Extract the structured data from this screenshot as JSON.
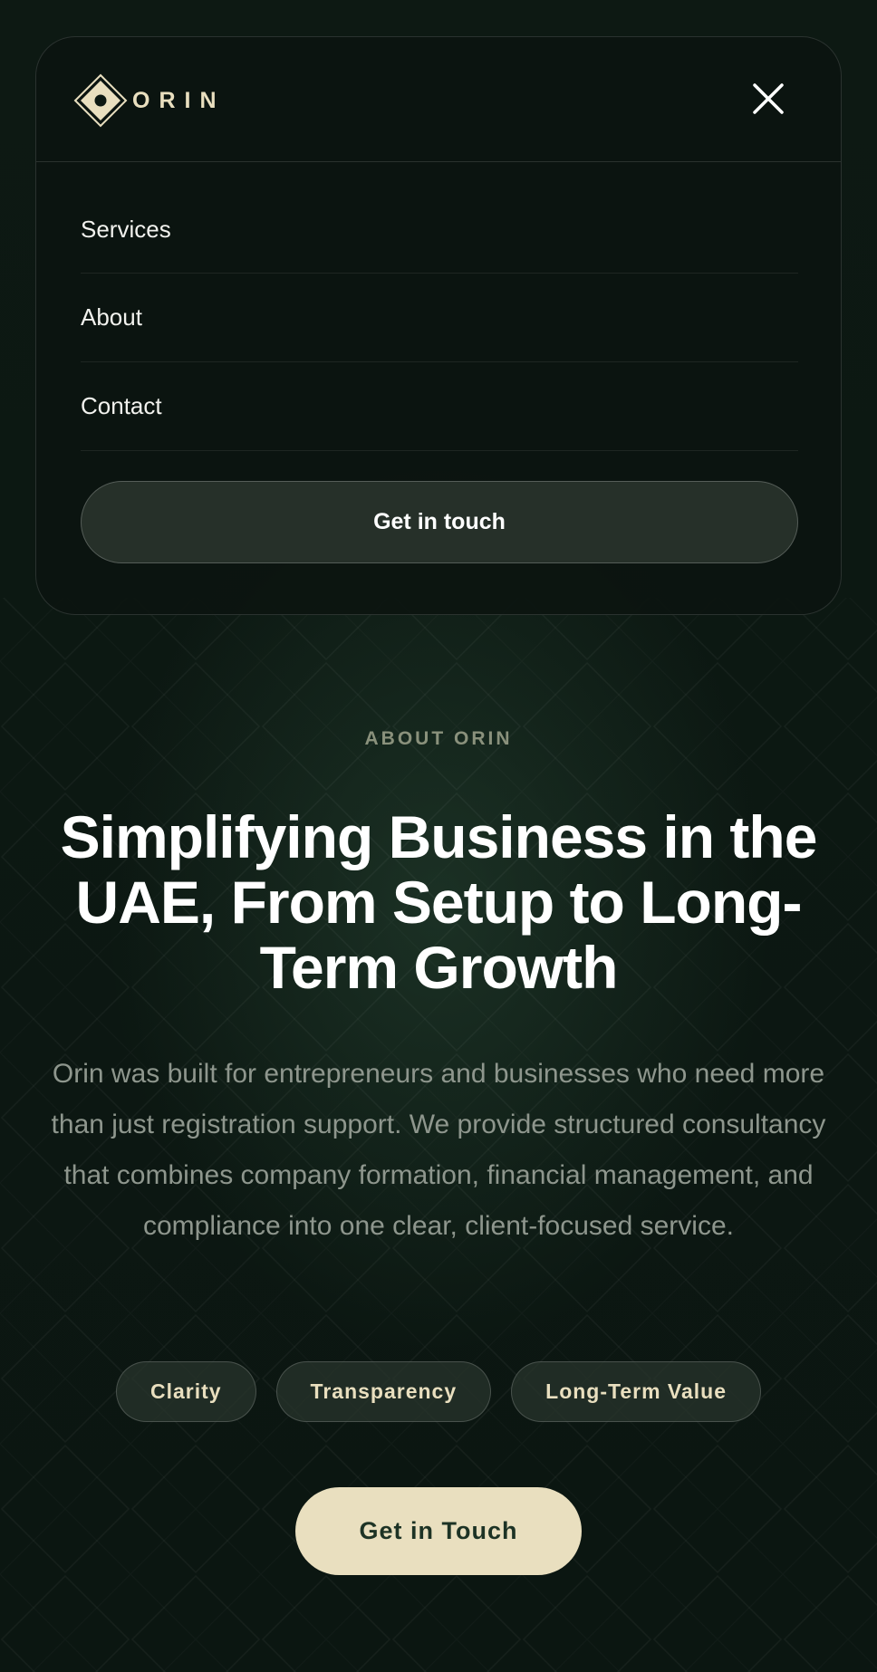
{
  "brand": {
    "name": "ORIN",
    "icon": "diamond-logo-icon",
    "accent_color": "#e9dfbf"
  },
  "menu": {
    "close_icon": "close-icon",
    "items": [
      {
        "label": "Services"
      },
      {
        "label": "About"
      },
      {
        "label": "Contact"
      }
    ],
    "cta_label": "Get in touch"
  },
  "hero": {
    "eyebrow": "ABOUT ORIN",
    "title": "Simplifying Business in the UAE, From Setup to Long-Term Growth",
    "description": "Orin was built for entrepreneurs and businesses who need more than just registration support. We provide structured consultancy that combines company formation, financial management, and compliance into one clear, client-focused service.",
    "tags": [
      {
        "label": "Clarity"
      },
      {
        "label": "Transparency"
      },
      {
        "label": "Long-Term Value"
      }
    ],
    "cta_label": "Get in Touch"
  },
  "colors": {
    "background": "#0c1812",
    "cta_background": "#e9dfbf",
    "cta_text": "#1d3325",
    "muted_text": "#8e968d"
  }
}
